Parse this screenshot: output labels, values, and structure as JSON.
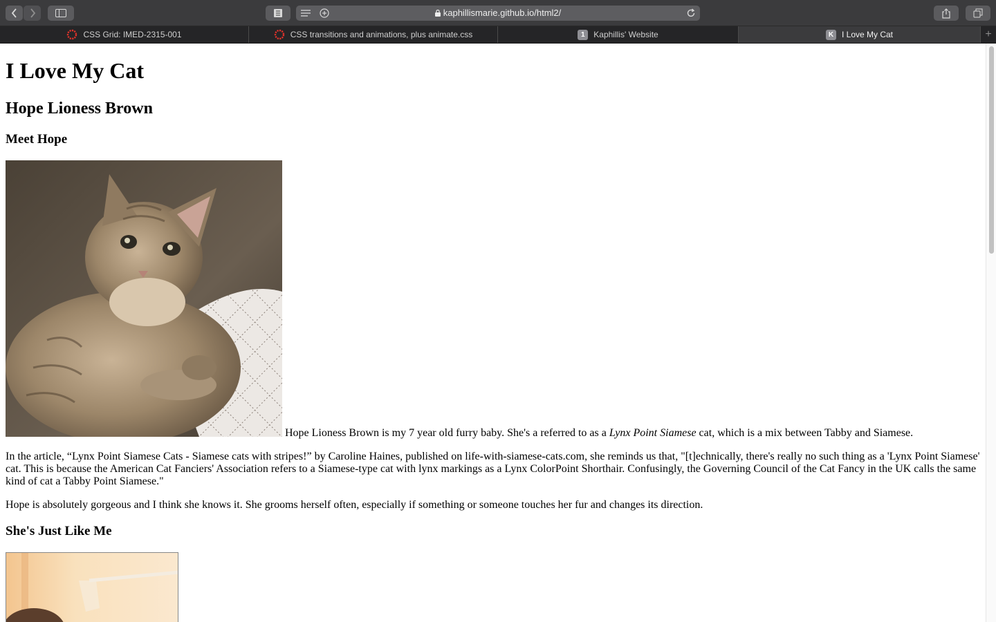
{
  "browser": {
    "url": "kaphillismarie.github.io/html2/",
    "tabs": [
      {
        "label": "CSS Grid: IMED-2315-001",
        "favicon": "red-ring-icon"
      },
      {
        "label": "CSS transitions and animations, plus animate.css",
        "favicon": "red-ring-icon"
      },
      {
        "label": "Kaphillis' Website",
        "favicon_letter": "1"
      },
      {
        "label": "I Love My Cat",
        "favicon_letter": "K",
        "active": true
      }
    ]
  },
  "page": {
    "title": "I Love My Cat",
    "subtitle": "Hope Lioness Brown",
    "section1_heading": "Meet Hope",
    "intro_before": "Hope Lioness Brown is my 7 year old furry baby. She's a referred to as a ",
    "intro_em": "Lynx Point Siamese",
    "intro_after": " cat, which is a mix between Tabby and Siamese.",
    "paragraph1": "In the article, “Lynx Point Siamese Cats - Siamese cats with stripes!” by Caroline Haines, published on life-with-siamese-cats.com, she reminds us that, \"[t]echnically, there's really no such thing as a 'Lynx Point Siamese' cat. This is because the American Cat Fanciers' Association refers to a Siamese-type cat with lynx markings as a Lynx ColorPoint Shorthair. Confusingly, the Governing Council of the Cat Fancy in the UK calls the same kind of cat a Tabby Point Siamese.\"",
    "paragraph2": "Hope is absolutely gorgeous and I think she knows it. She grooms herself often, especially if something or someone touches her fur and changes its direction.",
    "section2_heading": "She's Just Like Me"
  }
}
